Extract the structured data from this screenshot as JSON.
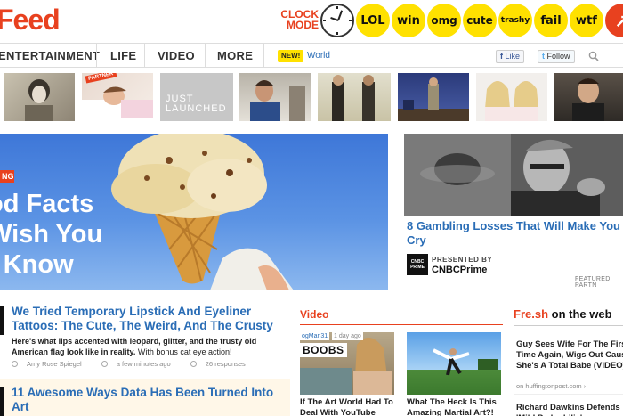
{
  "header": {
    "logo": "Feed",
    "clock_mode": "CLOCK MODE",
    "badges": [
      "LOL",
      "win",
      "omg",
      "cute",
      "trashy",
      "fail",
      "wtf"
    ]
  },
  "nav": {
    "items": [
      "ENTERTAINMENT",
      "LIFE",
      "VIDEO",
      "MORE"
    ],
    "new_badge": "NEW!",
    "world_link": "World",
    "fb_like": "Like",
    "tw_follow": "Follow"
  },
  "thumbs": {
    "partner_label": "PARTNER",
    "just_launched": "JUST LAUNCHED"
  },
  "hero": {
    "tag": "NG",
    "title_lines": [
      "od Facts",
      "Wish You",
      "t Know"
    ]
  },
  "feature": {
    "title": "8 Gambling Losses That Will Make You Cry",
    "presented_by": "PRESENTED BY",
    "logo_text": "CNBC PRIME",
    "sponsor": "CNBCPrime",
    "featured_partner": "FEATURED PARTN"
  },
  "stories": [
    {
      "title": "We Tried Temporary Lipstick And Eyeliner Tattoos: The Cute, The Weird, And The Crusty",
      "desc": "Here's what lips accented with leopard, glitter, and the trusty old American flag look like in reality.",
      "desc_sub": "With bonus cat eye action!",
      "author": "Amy Rose Spiegel",
      "time": "a few minutes ago",
      "responses": "26 responses"
    },
    {
      "title": "11 Awesome Ways Data Has Been Turned Into Art"
    }
  ],
  "video": {
    "heading": "Video",
    "items": [
      {
        "user": "ogMan31",
        "ago": "1 day ago",
        "overlay": "BOOBS",
        "caption": "If The Art World Had To Deal With YouTube"
      },
      {
        "caption": "What The Heck Is This Amazing Martial Art?!"
      }
    ]
  },
  "fresh": {
    "heading_brand": "Fre.sh",
    "heading_rest": " on the web",
    "items": [
      {
        "title": "Guy Sees Wife For The First Time Again, Wigs Out Cause She's A Total Babe (VIDEO)",
        "source": "on huffingtonpost.com ›"
      },
      {
        "title": "Richard Dawkins Defends 'Mild Pedophilia'"
      }
    ]
  }
}
